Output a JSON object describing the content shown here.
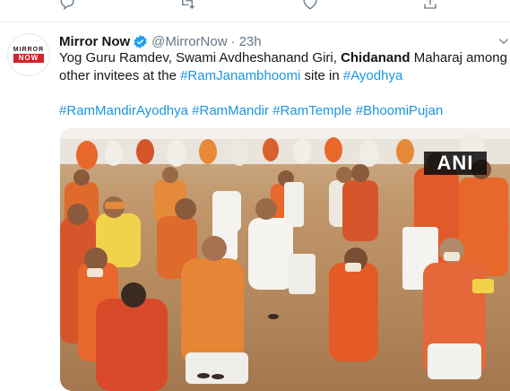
{
  "tweet": {
    "author_name": "Mirror Now",
    "handle": "@MirrorNow",
    "separator": "·",
    "time": "23h",
    "avatar_logo_top": "MIRROR",
    "avatar_logo_bottom": "NOW",
    "text_part1": "Yog Guru Ramdev, Swami Avdheshanand Giri, ",
    "text_bold": "Chidanand",
    "text_part2": " Maharaj among other invitees at the ",
    "text_link1": "#RamJanambhoomi",
    "text_part3": " site in ",
    "text_link2": "#Ayodhya",
    "hashtags": [
      "#RamMandirAyodhya",
      "#RamMandir",
      "#RamTemple",
      "#BhoomiPujan"
    ],
    "media_watermark": "ANI"
  },
  "colors": {
    "link": "#1b95e0",
    "secondary": "#657786",
    "verified": "#1da1f2",
    "saffron": "#e8672a",
    "carpet": "#b98a5e"
  },
  "icons": [
    "reply-icon",
    "retweet-icon",
    "like-icon",
    "share-icon",
    "verified-badge-icon",
    "caret-down-icon"
  ]
}
